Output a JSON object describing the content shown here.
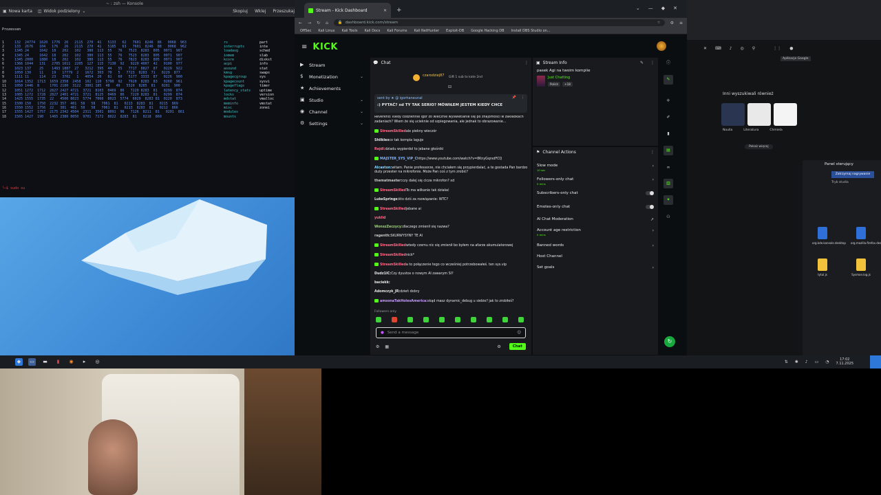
{
  "terminal": {
    "title_bar": "~ : zsh — Konsole",
    "tabs": [
      "Nowa karta",
      "Widok podzielony"
    ],
    "right_buttons": [
      "Skopiuj",
      "Wklej",
      "Przeszukaj"
    ],
    "header": "Prozessen",
    "rows": [
      {
        "c1": "1",
        "nums": "132  24774  1620  1776  26   2115  270  41   5133   62   7601  8246  86   0068  963",
        "name": "rs",
        "extra": "part"
      },
      {
        "c1": "2",
        "nums": "133  2676   104   176   26   2115  270  41   5185   63   7601  8246  88   0068  962",
        "name": "interrupts",
        "extra": "inte"
      },
      {
        "c1": "3",
        "nums": "1345 24     1642  18   202   102   380  113  55   76   7523  8283  805  0071  907",
        "name": "loadavg",
        "extra": "sched"
      },
      {
        "c1": "4",
        "nums": "1345 24     1642  18   202   102   380  113  55   76   7523  8283  805  0071  907",
        "name": "iomem",
        "extra": "slab"
      },
      {
        "c1": "5",
        "nums": "1345 2000   1880  18   202   102   380  113  55   76   7823  8283  805  0071  907",
        "name": "kcore",
        "extra": "diskst"
      },
      {
        "c1": "6",
        "nums": "1366 1044   131   2705 1011  2205  127  115  7130  92   9220 4007  42   0100  977",
        "name": "acpi",
        "extra": "info"
      },
      {
        "c1": "7",
        "nums": "1023 137    25    1493 1887  27   3212  395  44   55   7717  8827  87   0229  922",
        "name": "asound",
        "extra": "stat"
      },
      {
        "c1": "8",
        "nums": "1050 130    11    19   17779  2   1672  303  70   5   7723  8283  71   0229  877",
        "name": "kmsg",
        "extra": "swaps"
      },
      {
        "c1": "9",
        "nums": "1111 11     114   23   3702   1   4054  20   81   60   5177  3333  87   0226  900",
        "name": "kpagecgroup",
        "extra": "sys"
      },
      {
        "c1": "10",
        "nums": "1014 1352  1713  1659 2358  2458  102  110  5790  92   7920  8283  83   0260  961",
        "name": "kpagecount",
        "extra": "sysvi"
      },
      {
        "c1": "11",
        "nums": "1050 1446  8     1701 2180  3122  3801 185  48   49   5520  8285  81   0281  900",
        "name": "kpageflags",
        "extra": "timer"
      },
      {
        "c1": "12",
        "nums": "1051 1272  1712  2827 2427 4721  3721  8103  0469  86   7220 8283  81   0299  874",
        "name": "latency_stats",
        "extra": "uptime"
      },
      {
        "c1": "13",
        "nums": "1085 1272  1728  2827 2401 4721  3721  8125  0469  86   7220 8283  81   0299  874",
        "name": "locks",
        "extra": "version"
      },
      {
        "c1": "14",
        "nums": "1425 1555  1735  22   4506 8023  5774  7060  8023  5774  6029  8283 81  0220  873",
        "name": "mdstat",
        "extra": "vmalloc"
      },
      {
        "c1": "15",
        "nums": "1500 150   1750  2232 357  401  58   58   7061  81   0213  8283  81   0215  869",
        "name": "meminfo",
        "extra": "vmstat"
      },
      {
        "c1": "16",
        "nums": "1550 1552  1756  22   381  401  58   58   7061  81   0213  8283  81   0212  866",
        "name": "misc",
        "extra": "zonei"
      },
      {
        "c1": "17",
        "nums": "1555 1427  1757  2175 2342 4504  2311  3501  8091  96   7126  8211  81   0201  861",
        "name": "modules",
        "extra": ""
      },
      {
        "c1": "18",
        "nums": "1565 1427  190   1465 2380 8050  9701  7172  8022  8283  81   0218  860",
        "name": "mounts",
        "extra": ""
      }
    ],
    "prompt": "└─$ sudo su"
  },
  "browser": {
    "tab_title": "Stream - Kick Dashboard",
    "url": "dashboard.kick.com/stream",
    "bookmarks": [
      "OffSec",
      "Kali Linux",
      "Kali Tools",
      "Kali Docs",
      "Kali Forums",
      "Kali NetHunter",
      "Exploit-DB",
      "Google Hacking DB",
      "Install DBS Studio on..."
    ]
  },
  "kick": {
    "logo": "KICK",
    "sidebar": [
      {
        "label": "Stream",
        "icon": "▶",
        "chevron": ""
      },
      {
        "label": "Monetization",
        "icon": "$",
        "chevron": "⌄"
      },
      {
        "label": "Achievements",
        "icon": "★",
        "chevron": ""
      },
      {
        "label": "Studio",
        "icon": "▣",
        "chevron": "⌄"
      },
      {
        "label": "Channel",
        "icon": "◉",
        "chevron": "⌄"
      },
      {
        "label": "Settings",
        "icon": "⚙",
        "chevron": "⌄"
      }
    ],
    "chat": {
      "title": "Chat",
      "pinned_user": "czarodziej87",
      "pinned_text": "Gift 1 sub to kate 2nd",
      "pinbox_user": "sent by  ★ @ igorhaneunal",
      "pinbox_message": ":) PYTAĆ? xd TY TAK SERIO? MÓWIŁEM JESTEM KIEDY CHCE",
      "messages": [
        {
          "user": "",
          "color": "#e8e8e8",
          "text": "Reverend: kiedy codziennie igor zo wiecznie wyświetlanie się po znajomości w zakładkach zadaniach? Wiem że się ucieknie od szpiegowania, ale jednak to obrazowanie...",
          "badge": false
        },
        {
          "user": "StreamSkilled",
          "color": "#ff6b8a",
          "text": "ale piekny wieczór",
          "badge": true
        },
        {
          "user": "Shilklex",
          "color": "#e8e8e8",
          "text": "co tak kompia laguje",
          "badge": false
        },
        {
          "user": "Rejdl:",
          "color": "#ff6b8a",
          "text": "dziadu wypierdol to jebane głośniki",
          "badge": false
        },
        {
          "user": "MAJSTER_SYS_VIP_C",
          "color": "#7fb2ff",
          "text": "https://www.youtube.com/watch?v=8KnyGqrsdFCQ",
          "badge": true
        },
        {
          "user": "Alcaston:",
          "color": "#8fd8ff",
          "text": "witam. Panie professorze, nie chciałem się przypierdalać, a te gostada Pan bardzo duży przester na mikrofonie. Może Pan coś z tym zrobić?",
          "badge": false
        },
        {
          "user": "thematmaster:",
          "color": "#c9c9c9",
          "text": "czy dalej się cicza mikrofon? xd",
          "badge": false
        },
        {
          "user": "StreamSkilled",
          "color": "#ff6b8a",
          "text": "To ma wilkanie tak działać",
          "badge": true
        },
        {
          "user": "LukeSprings:",
          "color": "#e8e8e8",
          "text": "kto dziś za rozwiązanie: WTC?",
          "badge": false
        },
        {
          "user": "StreamSkilled",
          "color": "#ff6b8a",
          "text": "jebane ai",
          "badge": true
        },
        {
          "user": "yuklid",
          "color": "#ff6b8a",
          "text": "",
          "badge": false
        },
        {
          "user": "WonszZeczycy:",
          "color": "#9fd07a",
          "text": "dlaczego zmienił się nazwa?",
          "badge": false
        },
        {
          "user": "ragenth:",
          "color": "#c9c9c9",
          "text": "SKURWYSYNY TE AI",
          "badge": false
        },
        {
          "user": "StreamSkilled",
          "color": "#ff6b8a",
          "text": "wtedy czemu nic się zmienił bo byłem na afarze akumulatorowej",
          "badge": true
        },
        {
          "user": "StreamSkilled",
          "color": "#ff6b8a",
          "text": "nick*",
          "badge": true
        },
        {
          "user": "StreamSkilled",
          "color": "#ff6b8a",
          "text": "a to połączenie tego co wcześniej potrzebowałeś. ten sys.vip",
          "badge": true
        },
        {
          "user": "Dudz1IC:",
          "color": "#e8e8e8",
          "text": "Czy dyustos o nowym AI zawarym SI?",
          "badge": false
        },
        {
          "user": "baciekk:",
          "color": "#e8e8e8",
          "text": "",
          "badge": false
        },
        {
          "user": "Adomczyk_JR:",
          "color": "#e8e8e8",
          "text": "dzień dobry",
          "badge": false
        },
        {
          "user": "amsonaTakHolesAmerica:",
          "color": "#c69cff",
          "text": "skąd masz dynamic_debug u siebie? jak to zrobiłeś?",
          "badge": true
        }
      ],
      "followers_only": "Followers only",
      "input_placeholder": "Send a message",
      "chat_button": "Chat"
    },
    "stream_info": {
      "title": "Stream Info",
      "stream_title": "pasek Agi na twoim komplie",
      "category": "Just Chatting",
      "tags": [
        "Polish",
        "+18"
      ]
    },
    "channel_actions": {
      "title": "Channel Actions",
      "items": [
        {
          "label": "Slow mode",
          "sub": "10 sec",
          "control": "›"
        },
        {
          "label": "Followers-only chat",
          "sub": "0 mins",
          "control": "›"
        },
        {
          "label": "Subscribers-only chat",
          "sub": "",
          "control": "toggle"
        },
        {
          "label": "Emotes-only chat",
          "sub": "",
          "control": "toggle"
        },
        {
          "label": "AI Chat Moderation",
          "sub": "",
          "control": "↗"
        },
        {
          "label": "Account age restriction",
          "sub": "0 mins",
          "control": "›"
        },
        {
          "label": "Banned words",
          "sub": "",
          "control": "›"
        },
        {
          "label": "Host Channel",
          "sub": "",
          "control": ""
        },
        {
          "label": "Set goals",
          "sub": "",
          "control": "›"
        }
      ]
    }
  },
  "right_window": {
    "tooltip": "Aplikacje Google",
    "people_also_search": "Inni wyszukiwali również",
    "image_labels": [
      "Noulla",
      "Literatura",
      "Chmiela"
    ],
    "more": "Pokaż więcej",
    "panel_title": "Panel sterujący",
    "panel_btn": "Zatrzymaj nagrywanie",
    "panel_btn2": "Tryb studia",
    "files": [
      {
        "name": "org.kde.konsole.desktop",
        "color": "#2f6fd8"
      },
      {
        "name": "org.mozilla.firefox.desktop",
        "color": "#2f6fd8"
      },
      {
        "name": "tytul.js",
        "color": "#f2c23a"
      },
      {
        "name": "Sysmon.log.js",
        "color": "#f2c23a"
      }
    ]
  },
  "taskbar": {
    "time": "17:02",
    "date": "7.11.2025"
  }
}
